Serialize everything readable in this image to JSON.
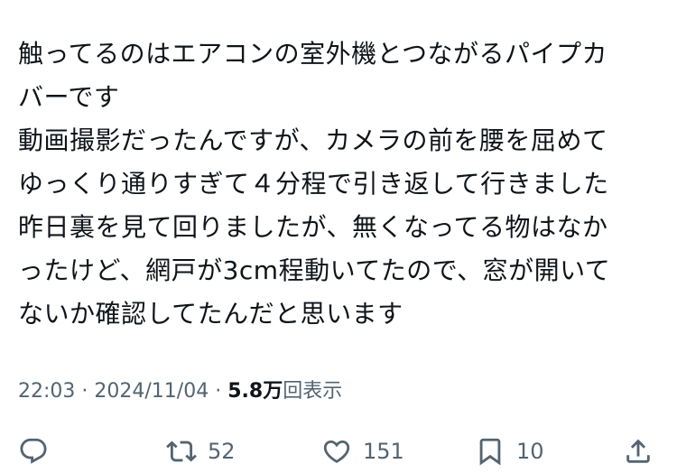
{
  "tweet": {
    "lines": [
      "触ってるのはエアコンの室外機とつながるパイプカ",
      "バーです",
      "動画撮影だったんですが、カメラの前を腰を屈めて",
      "ゆっくり通りすぎて４分程で引き返して行きました",
      "昨日裏を見て回りましたが、無くなってる物はなか",
      "ったけど、網戸が3cm程動いてたので、窓が開いて",
      "ないか確認してたんだと思います"
    ]
  },
  "meta": {
    "time": "22:03",
    "separator": "·",
    "date": "2024/11/04",
    "views_count": "5.8万",
    "views_label": "回表示"
  },
  "actions": {
    "reply": {
      "icon": "reply-icon",
      "count": ""
    },
    "repost": {
      "icon": "repost-icon",
      "count": "52"
    },
    "like": {
      "icon": "heart-icon",
      "count": "151"
    },
    "bookmark": {
      "icon": "bookmark-icon",
      "count": "10"
    },
    "share": {
      "icon": "share-icon",
      "count": ""
    }
  },
  "colors": {
    "text": "#0f1419",
    "secondary": "#536471",
    "background": "#ffffff"
  }
}
